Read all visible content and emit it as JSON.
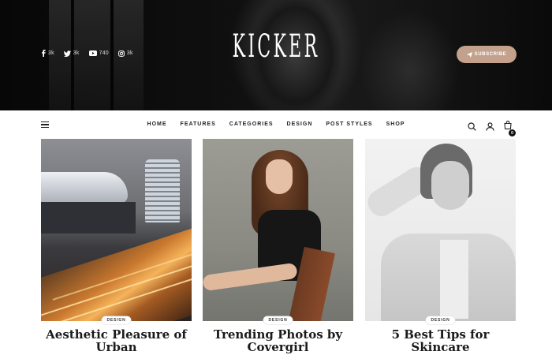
{
  "site": {
    "logo": "KICKER",
    "subscribe_label": "SUBSCRIBE"
  },
  "social": [
    {
      "icon": "facebook-icon",
      "count": "3k"
    },
    {
      "icon": "twitter-icon",
      "count": "3k"
    },
    {
      "icon": "youtube-icon",
      "count": "740"
    },
    {
      "icon": "instagram-icon",
      "count": "3k"
    }
  ],
  "nav": {
    "items": [
      "HOME",
      "FEATURES",
      "CATEGORIES",
      "DESIGN",
      "POST STYLES",
      "SHOP"
    ],
    "cart_count": "0"
  },
  "posts": [
    {
      "tag": "DESIGN",
      "title": "Aesthetic Pleasure of Urban"
    },
    {
      "tag": "DESIGN",
      "title": "Trending Photos by Covergirl"
    },
    {
      "tag": "DESIGN",
      "title": "5 Best Tips for Skincare"
    }
  ],
  "colors": {
    "accent": "#c3a18c",
    "hero_bg": "#0b0b0b"
  }
}
